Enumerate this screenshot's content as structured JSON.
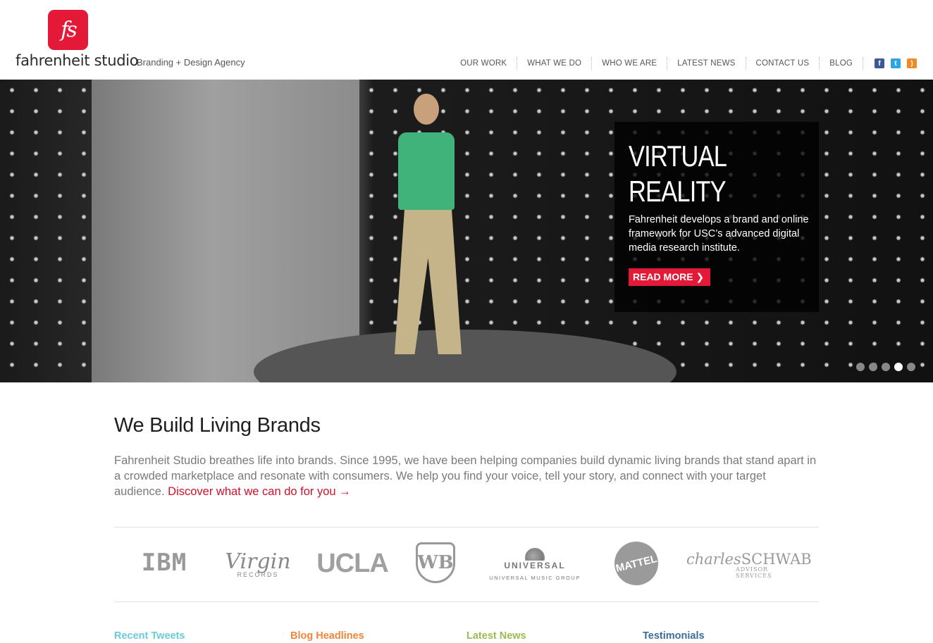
{
  "brand": {
    "logo_glyph": "fs",
    "name": "fahrenheit studio",
    "tagline": "Branding + Design Agency",
    "accent_color": "#e31937"
  },
  "nav": {
    "items": [
      "OUR WORK",
      "WHAT WE DO",
      "WHO WE ARE",
      "LATEST NEWS",
      "CONTACT US",
      "BLOG"
    ],
    "social": [
      {
        "icon": "facebook-icon",
        "glyph": "f"
      },
      {
        "icon": "twitter-icon",
        "glyph": "t"
      },
      {
        "icon": "rss-icon",
        "glyph": ")"
      }
    ]
  },
  "hero": {
    "title_line1": "VIRTUAL",
    "title_line2": "REALITY",
    "description": "Fahrenheit develops a brand and online framework for USC’s advanced digital media research institute.",
    "button_label": "READ MORE ❯",
    "slide_count": 5,
    "active_slide": 4
  },
  "intro": {
    "title": "We Build Living Brands",
    "text": "Fahrenheit Studio breathes life into brands. Since 1995, we have been helping companies build dynamic living brands that stand apart in a crowded marketplace and resonate with consumers. We help you find your voice, tell your story, and connect with your target audience.",
    "link": "Discover what we can do for you →"
  },
  "clients": {
    "ibm": "IBM",
    "virgin": "Virgin",
    "virgin_sub": "RECORDS",
    "ucla": "UCLA",
    "wb": "WB",
    "universal": "UNIVERSAL",
    "universal_sub": "UNIVERSAL MUSIC GROUP",
    "mattel": "MATTEL",
    "schwab_1": "charles",
    "schwab_2": "SCHWAB",
    "schwab_sub": "ADVISOR SERVICES"
  },
  "columns": {
    "tweets": "Recent Tweets",
    "blog": "Blog Headlines",
    "news": "Latest News",
    "testimonials": "Testimonials"
  }
}
